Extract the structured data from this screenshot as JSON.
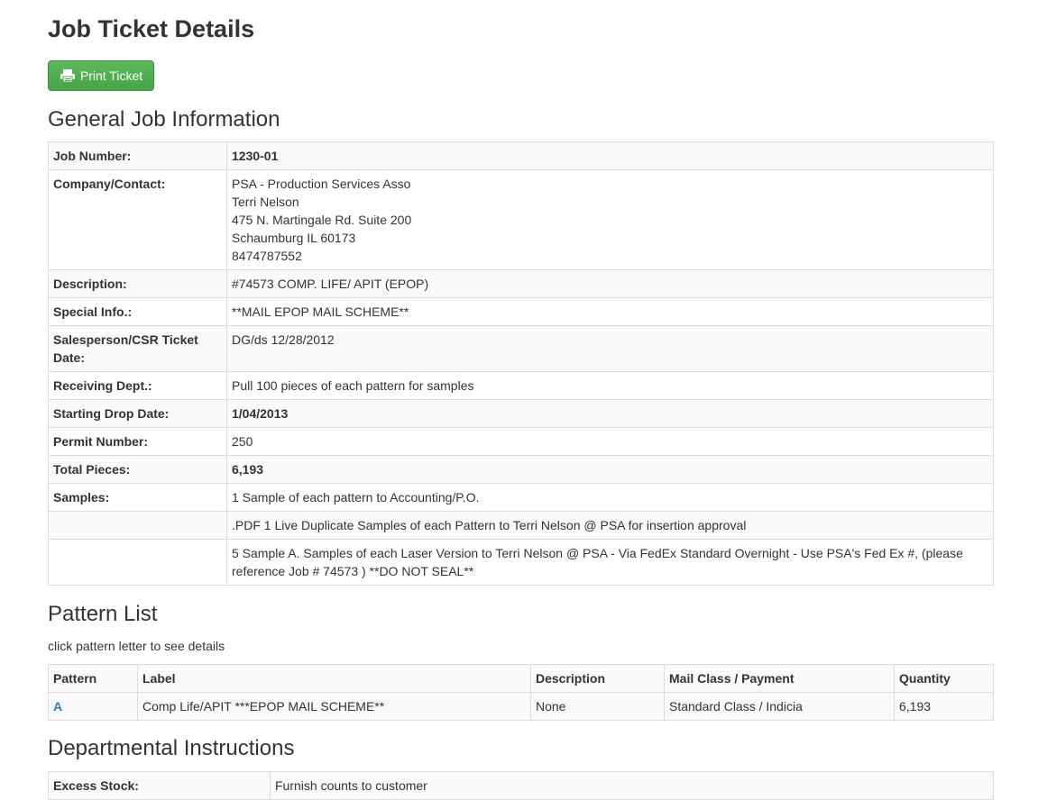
{
  "page": {
    "title": "Job Ticket Details",
    "print_label": "Print Ticket"
  },
  "general": {
    "heading": "General Job Information",
    "job_number_label": "Job Number:",
    "job_number": "1230-01",
    "company_label": "Company/Contact:",
    "company_lines": [
      "PSA - Production Services Asso",
      "Terri Nelson",
      "475 N. Martingale Rd. Suite 200",
      "Schaumburg IL 60173",
      "8474787552"
    ],
    "description_label": "Description:",
    "description": "#74573 COMP. LIFE/ APIT (EPOP)",
    "special_label": "Special Info.:",
    "special": "**MAIL EPOP MAIL SCHEME**",
    "salesperson_label": "Salesperson/CSR Ticket Date:",
    "salesperson": "DG/ds 12/28/2012",
    "receiving_label": "Receiving Dept.:",
    "receiving": "Pull 100 pieces of each pattern for samples",
    "drop_label": "Starting Drop Date:",
    "drop": "1/04/2013",
    "permit_label": "Permit Number:",
    "permit": "250",
    "total_label": "Total Pieces:",
    "total": "6,193",
    "samples_label": "Samples:",
    "samples": [
      "1 Sample of each pattern to Accounting/P.O.",
      ".PDF 1 Live Duplicate Samples of each Pattern to Terri Nelson @ PSA for insertion approval",
      "5 Sample A. Samples of each Laser Version to Terri Nelson @ PSA - Via FedEx Standard Overnight - Use PSA's Fed Ex #, (please reference Job # 74573 ) **DO NOT SEAL**"
    ]
  },
  "patterns": {
    "heading": "Pattern List",
    "hint": "click pattern letter to see details",
    "columns": [
      "Pattern",
      "Label",
      "Description",
      "Mail Class / Payment",
      "Quantity"
    ],
    "rows": [
      [
        "A",
        "Comp Life/APIT ***EPOP MAIL SCHEME**",
        "None",
        "Standard Class / Indicia",
        "6,193"
      ]
    ]
  },
  "departmental": {
    "heading": "Departmental Instructions",
    "excess_label": "Excess Stock:",
    "excess": "Furnish counts to customer"
  },
  "colors": {
    "button": "#5cb85c",
    "link": "#337ab7",
    "stripe": "#f9f9f9",
    "border": "#dddddd"
  }
}
